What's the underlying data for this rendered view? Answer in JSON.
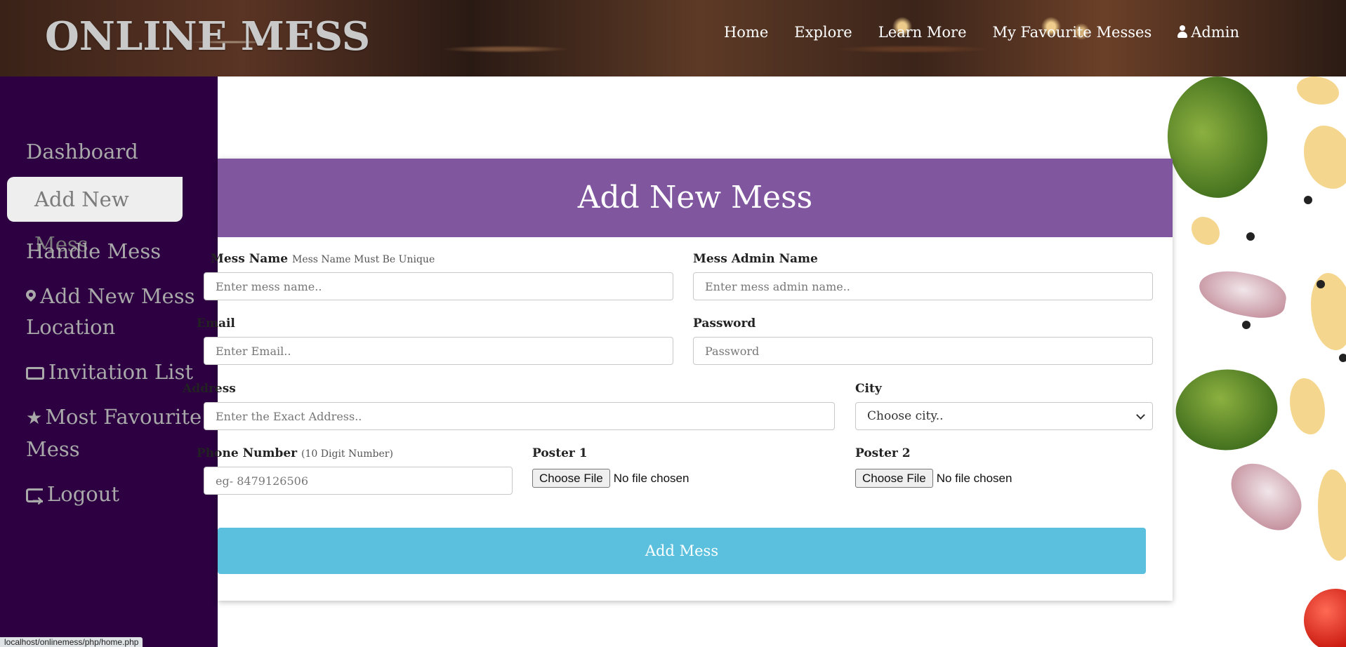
{
  "brand": "ONLINE MESS",
  "nav": {
    "home": "Home",
    "explore": "Explore",
    "learn_more": "Learn More",
    "favourites": "My Favourite Messes",
    "admin": "Admin"
  },
  "sidebar": {
    "items": [
      {
        "label": "Dashboard"
      },
      {
        "label": "Add New Mess"
      },
      {
        "label": "Handle Mess"
      },
      {
        "label": "Add New Mess Location"
      },
      {
        "label": "Invitation List"
      },
      {
        "label": "Most Favourite Mess"
      },
      {
        "label": "Logout"
      }
    ]
  },
  "form": {
    "title": "Add New Mess",
    "mess_name": {
      "label": "Mess Name",
      "hint": "Mess Name Must Be Unique",
      "placeholder": "Enter mess name.."
    },
    "admin_name": {
      "label": "Mess Admin Name",
      "placeholder": "Enter mess admin name.."
    },
    "email": {
      "label": "Email",
      "placeholder": "Enter Email.."
    },
    "password": {
      "label": "Password",
      "placeholder": "Password"
    },
    "address": {
      "label": "Address",
      "placeholder": "Enter the Exact Address.."
    },
    "city": {
      "label": "City",
      "selected": "Choose city.."
    },
    "phone": {
      "label": "Phone Number",
      "hint": "(10 Digit Number)",
      "placeholder": "eg- 8479126506"
    },
    "poster1": {
      "label": "Poster 1",
      "button": "Choose File",
      "status": "No file chosen"
    },
    "poster2": {
      "label": "Poster 2",
      "button": "Choose File",
      "status": "No file chosen"
    },
    "submit": "Add Mess"
  },
  "status_url": "localhost/onlinemess/php/home.php"
}
